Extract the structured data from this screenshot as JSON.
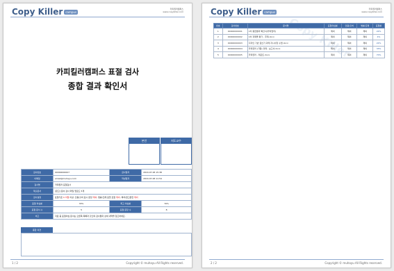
{
  "brand": {
    "name": "Copy Killer",
    "badge": "campus"
  },
  "header_right": {
    "line1": "카피킬러캠퍼스",
    "line2": "www.copykiller.com"
  },
  "footer": {
    "copyright": "Copyright © muhayu All Rights reserved."
  },
  "page1": {
    "title_line1": "카피킬러캠퍼스 표절 검사",
    "title_line2": "종합 결과 확인서",
    "sign_labels": [
      "본인",
      "지도교수"
    ],
    "page_no": "1 / 2",
    "info_rows": [
      {
        "k1": "검사번호",
        "v1": "00000000007",
        "k2": "검사일자",
        "v2": "2016.07.28 15:38"
      },
      {
        "k1": "이메일",
        "v1": "email@muhayu.com",
        "k2": "작성일자",
        "v2": "2016.07.28 11:54"
      },
      {
        "k1": "검사명",
        "v1": "카피킬러 표절검사"
      },
      {
        "k1": "제출문서",
        "v1": "[참고] 문서 검사 파일 업로드 5개"
      },
      {
        "k1": "검사설정",
        "v1_a": "표절기준 ",
        "v1_b": "6 어절",
        "v1_c": " 이상, 인용/출처 표시 문장 ",
        "v1_d": "제외",
        "v1_e": ", 법률/조례 표현 포함 ",
        "v1_f": "제외",
        "v1_g": ", 목차/참고문헌 ",
        "v1_h": "제외"
      },
      {
        "k1": "표절 의심률",
        "v1": "33%",
        "k2": "최고 의심률",
        "v2": "70%"
      },
      {
        "k1": "표절 문서 수",
        "v1": "5",
        "k2": "표절 문장 수",
        "v2": "8"
      },
      {
        "k1": "비고",
        "v1": "자료 중 표절의심 문서는 오른쪽 목록과 같으며 검사결과 상세 내역을 참고하세요."
      }
    ],
    "opinion_label": "종합 의견"
  },
  "page2": {
    "page_no": "2 / 2",
    "columns": [
      "번호",
      "검사번호",
      "문서명",
      "표절의심률",
      "인용/출처",
      "법률/조례",
      "표절률"
    ],
    "rows": [
      [
        "1",
        "00000000001",
        "1차 종합결과 확인서(카피킬러)",
        "제외",
        "제외",
        "제외",
        "22%"
      ],
      [
        "2",
        "00000000002",
        "1차 과제물 평가 - 주제.docx",
        "제외",
        "제외",
        "제외",
        "4%"
      ],
      [
        "3",
        "00000000003",
        "디자인 기반 글쓰기 과제 지시사항 수업.docx",
        "제외",
        "제외",
        "제외",
        "22%"
      ],
      [
        "4",
        "00000000004",
        "카피킬러 (기말) 과제 - 보고서.docx",
        "제외",
        "제외",
        "제외",
        "33%"
      ],
      [
        "5",
        "00000000005",
        "카피킬러 - 레포트.docx",
        "제외",
        "제외",
        "제외",
        "70%"
      ]
    ]
  },
  "colors": {
    "accent": "#3f6aa6",
    "brand": "#3f5f8c",
    "red": "#dd2222"
  }
}
